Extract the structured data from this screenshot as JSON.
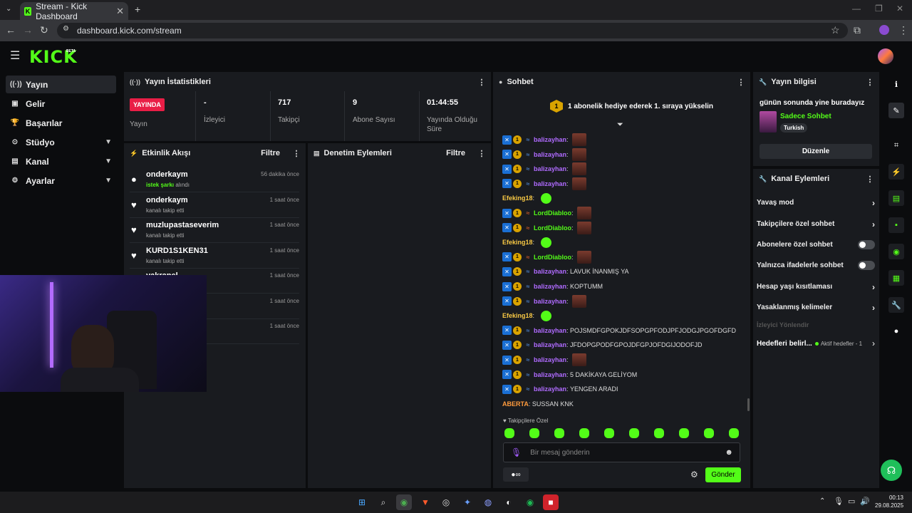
{
  "browser": {
    "tab_title": "Stream - Kick Dashboard",
    "url": "dashboard.kick.com/stream"
  },
  "header": {
    "logo": "KICK",
    "beta": "BETA"
  },
  "sidebar": {
    "items": [
      {
        "label": "Yayın",
        "icon": "broadcast-icon"
      },
      {
        "label": "Gelir",
        "icon": "revenue-icon"
      },
      {
        "label": "Başarılar",
        "icon": "trophy-icon"
      },
      {
        "label": "Stüdyo",
        "icon": "studio-icon"
      },
      {
        "label": "Kanal",
        "icon": "channel-icon"
      },
      {
        "label": "Ayarlar",
        "icon": "gear-icon"
      }
    ]
  },
  "stats": {
    "title": "Yayın İstatistikleri",
    "live_badge": "YAYINDA",
    "live_label": "Yayın",
    "viewers_value": "-",
    "viewers_label": "İzleyici",
    "followers_value": "717",
    "followers_label": "Takipçi",
    "subs_value": "9",
    "subs_label": "Abone Sayısı",
    "duration_value": "01:44:55",
    "duration_label": "Yayında Olduğu Süre"
  },
  "activity": {
    "title": "Etkinlik Akışı",
    "filter": "Filtre",
    "events": [
      {
        "name": "onderkaym",
        "sub_hl": "istek şarkı",
        "sub": " alındı",
        "time": "56 dakika önce"
      },
      {
        "name": "onderkaym",
        "sub_hl": "",
        "sub": "kanalı takip etti",
        "time": "1 saat önce"
      },
      {
        "name": "muzlupastaseverim",
        "sub_hl": "",
        "sub": "kanalı takip etti",
        "time": "1 saat önce"
      },
      {
        "name": "KURD1S1KEN31",
        "sub_hl": "",
        "sub": "kanalı takip etti",
        "time": "1 saat önce"
      },
      {
        "name": "yakrapel",
        "sub_hl": "",
        "sub": "",
        "time": "1 saat önce"
      },
      {
        "name": "",
        "sub_hl": "",
        "sub": "",
        "time": "1 saat önce"
      },
      {
        "name": "",
        "sub_hl": "",
        "sub": "",
        "time": "1 saat önce"
      }
    ]
  },
  "moderation": {
    "title": "Denetim Eylemleri",
    "filter": "Filtre"
  },
  "chat": {
    "title": "Sohbet",
    "pinned_rank": "1",
    "pinned": "1 abonelik hediye ederek 1. sıraya yükselin",
    "messages": [
      {
        "user": "balizayhan",
        "color": "purple",
        "text": "",
        "emote": true,
        "badges": true
      },
      {
        "user": "balizayhan",
        "color": "purple",
        "text": "",
        "emote": true,
        "badges": true
      },
      {
        "user": "balizayhan",
        "color": "purple",
        "text": "",
        "emote": true,
        "badges": true
      },
      {
        "user": "balizayhan",
        "color": "purple",
        "text": "",
        "emote": true,
        "badges": true
      },
      {
        "user": "Efeking18",
        "color": "yellow",
        "text": "",
        "gem": true,
        "badges": false
      },
      {
        "user": "LordDiabloo",
        "color": "green",
        "text": "",
        "emote": true,
        "badges": true
      },
      {
        "user": "LordDiabloo",
        "color": "green",
        "text": "",
        "emote": true,
        "badges": true
      },
      {
        "user": "Efeking18",
        "color": "yellow",
        "text": "",
        "gem": true,
        "badges": false
      },
      {
        "user": "LordDiabloo",
        "color": "green",
        "text": "",
        "emote": true,
        "badges": true
      },
      {
        "user": "balizayhan",
        "color": "purple",
        "text": "LAVUK İNANMIŞ YA",
        "badges": true
      },
      {
        "user": "balizayhan",
        "color": "purple",
        "text": "KOPTUMM",
        "badges": true
      },
      {
        "user": "balizayhan",
        "color": "purple",
        "text": "",
        "emote": true,
        "badges": true
      },
      {
        "user": "Efeking18",
        "color": "yellow",
        "text": "",
        "gem": true,
        "badges": false
      },
      {
        "user": "balizayhan",
        "color": "purple",
        "text": "POJSMDFGPOKJDFSOPGPFODJPFJODGJPGOFDGFD",
        "badges": true
      },
      {
        "user": "balizayhan",
        "color": "purple",
        "text": "JFDOPGPODFGPOJDFGPJOFDGIJODOFJD",
        "badges": true
      },
      {
        "user": "balizayhan",
        "color": "purple",
        "text": "",
        "emote": true,
        "badges": true
      },
      {
        "user": "balizayhan",
        "color": "purple",
        "text": "5 DAKİKAYA GELİYOM",
        "badges": true
      },
      {
        "user": "balizayhan",
        "color": "purple",
        "text": "YENGEN ARADI",
        "badges": true
      },
      {
        "user": "ABERTA",
        "color": "orange",
        "text": "SUSSAN KNK",
        "badges": false
      }
    ],
    "followers_only_label": "Takipçilere Özel",
    "input_placeholder": "Bir mesaj gönderin",
    "send": "Gönder"
  },
  "stream_info": {
    "title": "Yayın bilgisi",
    "stream_title": "günün sonunda yine buradayız",
    "category": "Sadece Sohbet",
    "tag": "Turkish",
    "edit": "Düzenle"
  },
  "channel_actions": {
    "title": "Kanal Eylemleri",
    "items": [
      {
        "label": "Yavaş mod",
        "type": "chevron"
      },
      {
        "label": "Takipçilere özel sohbet",
        "type": "chevron"
      },
      {
        "label": "Abonelere özel sohbet",
        "type": "toggle"
      },
      {
        "label": "Yalnızca ifadelerle sohbet",
        "type": "toggle"
      },
      {
        "label": "Hesap yaşı kısıtlaması",
        "type": "chevron"
      },
      {
        "label": "Yasaklanmış kelimeler",
        "type": "chevron"
      }
    ],
    "section": "İzleyici Yönlendir",
    "goals_label": "Hedefleri belirl...",
    "goals_status": "Aktif hedefler - 1"
  },
  "taskbar": {
    "time": "00:13",
    "date": "29.08.2025"
  },
  "colors": {
    "accent": "#53fc18",
    "live": "#e91e46",
    "panel": "#191b1f"
  }
}
